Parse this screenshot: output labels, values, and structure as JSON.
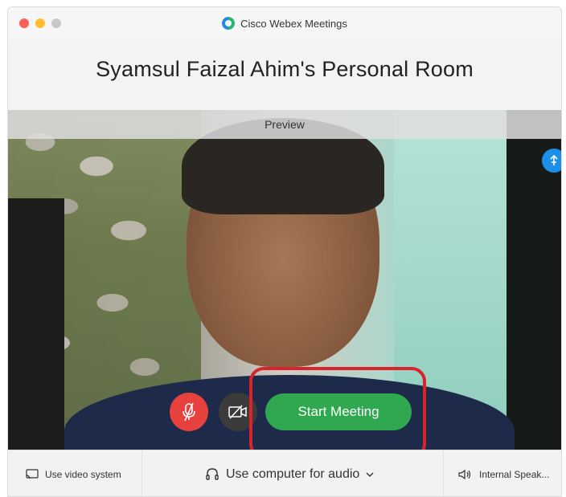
{
  "window": {
    "app_title": "Cisco Webex Meetings"
  },
  "room": {
    "title": "Syamsul Faizal Ahim's Personal Room"
  },
  "preview": {
    "label": "Preview"
  },
  "controls": {
    "mute_icon": "microphone-muted-icon",
    "video_icon": "video-off-icon",
    "start_meeting_label": "Start Meeting"
  },
  "bottom_bar": {
    "video_system_label": "Use video system",
    "audio_label": "Use computer for audio",
    "speaker_label": "Internal Speak..."
  },
  "colors": {
    "start_button": "#2fa84f",
    "mute_button": "#e6413c",
    "highlight": "#d8242a"
  }
}
